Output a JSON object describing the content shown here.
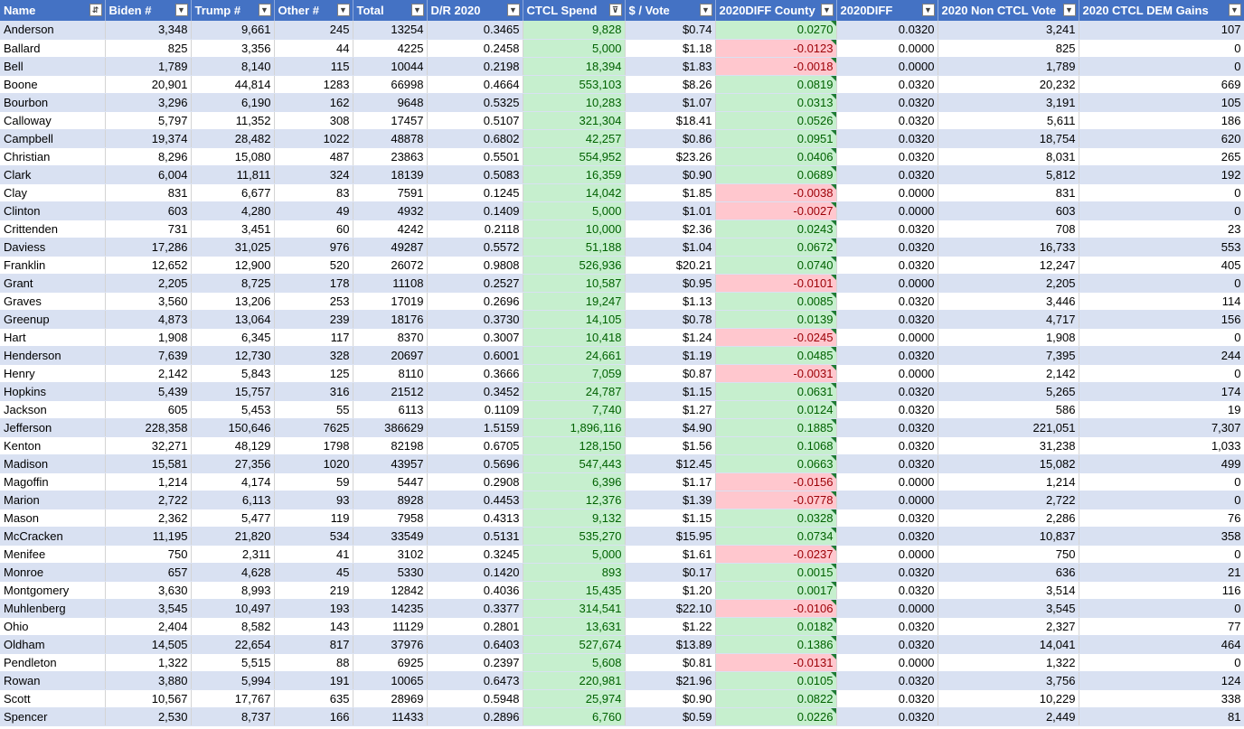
{
  "headers": [
    {
      "label": "Name",
      "filter_icon": "sort-asc-filter-icon"
    },
    {
      "label": "Biden #",
      "filter_icon": "filter-dropdown-icon"
    },
    {
      "label": "Trump #",
      "filter_icon": "filter-dropdown-icon"
    },
    {
      "label": "Other #",
      "filter_icon": "filter-dropdown-icon"
    },
    {
      "label": "Total",
      "filter_icon": "filter-dropdown-icon"
    },
    {
      "label": "D/R 2020",
      "filter_icon": "filter-dropdown-icon"
    },
    {
      "label": "CTCL Spend",
      "filter_icon": "filter-active-icon"
    },
    {
      "label": "$ / Vote",
      "filter_icon": "filter-dropdown-icon"
    },
    {
      "label": "2020DIFF County",
      "filter_icon": "filter-dropdown-icon"
    },
    {
      "label": "2020DIFF",
      "filter_icon": "filter-dropdown-icon"
    },
    {
      "label": "2020 Non CTCL Vote",
      "filter_icon": "filter-dropdown-icon"
    },
    {
      "label": "2020 CTCL DEM Gains",
      "filter_icon": "filter-dropdown-icon"
    }
  ],
  "colors": {
    "header_bg": "#4472c4",
    "band": "#d9e1f2",
    "good_fill": "#c6efce",
    "good_text": "#006100",
    "bad_fill": "#ffc7ce",
    "bad_text": "#9c0006"
  },
  "rows": [
    [
      "Anderson",
      "3,348",
      "9,661",
      "245",
      "13254",
      "0.3465",
      "9,828",
      "$0.74",
      "0.0270",
      "0.0320",
      "3,241",
      "107"
    ],
    [
      "Ballard",
      "825",
      "3,356",
      "44",
      "4225",
      "0.2458",
      "5,000",
      "$1.18",
      "-0.0123",
      "0.0000",
      "825",
      "0"
    ],
    [
      "Bell",
      "1,789",
      "8,140",
      "115",
      "10044",
      "0.2198",
      "18,394",
      "$1.83",
      "-0.0018",
      "0.0000",
      "1,789",
      "0"
    ],
    [
      "Boone",
      "20,901",
      "44,814",
      "1283",
      "66998",
      "0.4664",
      "553,103",
      "$8.26",
      "0.0819",
      "0.0320",
      "20,232",
      "669"
    ],
    [
      "Bourbon",
      "3,296",
      "6,190",
      "162",
      "9648",
      "0.5325",
      "10,283",
      "$1.07",
      "0.0313",
      "0.0320",
      "3,191",
      "105"
    ],
    [
      "Calloway",
      "5,797",
      "11,352",
      "308",
      "17457",
      "0.5107",
      "321,304",
      "$18.41",
      "0.0526",
      "0.0320",
      "5,611",
      "186"
    ],
    [
      "Campbell",
      "19,374",
      "28,482",
      "1022",
      "48878",
      "0.6802",
      "42,257",
      "$0.86",
      "0.0951",
      "0.0320",
      "18,754",
      "620"
    ],
    [
      "Christian",
      "8,296",
      "15,080",
      "487",
      "23863",
      "0.5501",
      "554,952",
      "$23.26",
      "0.0406",
      "0.0320",
      "8,031",
      "265"
    ],
    [
      "Clark",
      "6,004",
      "11,811",
      "324",
      "18139",
      "0.5083",
      "16,359",
      "$0.90",
      "0.0689",
      "0.0320",
      "5,812",
      "192"
    ],
    [
      "Clay",
      "831",
      "6,677",
      "83",
      "7591",
      "0.1245",
      "14,042",
      "$1.85",
      "-0.0038",
      "0.0000",
      "831",
      "0"
    ],
    [
      "Clinton",
      "603",
      "4,280",
      "49",
      "4932",
      "0.1409",
      "5,000",
      "$1.01",
      "-0.0027",
      "0.0000",
      "603",
      "0"
    ],
    [
      "Crittenden",
      "731",
      "3,451",
      "60",
      "4242",
      "0.2118",
      "10,000",
      "$2.36",
      "0.0243",
      "0.0320",
      "708",
      "23"
    ],
    [
      "Daviess",
      "17,286",
      "31,025",
      "976",
      "49287",
      "0.5572",
      "51,188",
      "$1.04",
      "0.0672",
      "0.0320",
      "16,733",
      "553"
    ],
    [
      "Franklin",
      "12,652",
      "12,900",
      "520",
      "26072",
      "0.9808",
      "526,936",
      "$20.21",
      "0.0740",
      "0.0320",
      "12,247",
      "405"
    ],
    [
      "Grant",
      "2,205",
      "8,725",
      "178",
      "11108",
      "0.2527",
      "10,587",
      "$0.95",
      "-0.0101",
      "0.0000",
      "2,205",
      "0"
    ],
    [
      "Graves",
      "3,560",
      "13,206",
      "253",
      "17019",
      "0.2696",
      "19,247",
      "$1.13",
      "0.0085",
      "0.0320",
      "3,446",
      "114"
    ],
    [
      "Greenup",
      "4,873",
      "13,064",
      "239",
      "18176",
      "0.3730",
      "14,105",
      "$0.78",
      "0.0139",
      "0.0320",
      "4,717",
      "156"
    ],
    [
      "Hart",
      "1,908",
      "6,345",
      "117",
      "8370",
      "0.3007",
      "10,418",
      "$1.24",
      "-0.0245",
      "0.0000",
      "1,908",
      "0"
    ],
    [
      "Henderson",
      "7,639",
      "12,730",
      "328",
      "20697",
      "0.6001",
      "24,661",
      "$1.19",
      "0.0485",
      "0.0320",
      "7,395",
      "244"
    ],
    [
      "Henry",
      "2,142",
      "5,843",
      "125",
      "8110",
      "0.3666",
      "7,059",
      "$0.87",
      "-0.0031",
      "0.0000",
      "2,142",
      "0"
    ],
    [
      "Hopkins",
      "5,439",
      "15,757",
      "316",
      "21512",
      "0.3452",
      "24,787",
      "$1.15",
      "0.0631",
      "0.0320",
      "5,265",
      "174"
    ],
    [
      "Jackson",
      "605",
      "5,453",
      "55",
      "6113",
      "0.1109",
      "7,740",
      "$1.27",
      "0.0124",
      "0.0320",
      "586",
      "19"
    ],
    [
      "Jefferson",
      "228,358",
      "150,646",
      "7625",
      "386629",
      "1.5159",
      "1,896,116",
      "$4.90",
      "0.1885",
      "0.0320",
      "221,051",
      "7,307"
    ],
    [
      "Kenton",
      "32,271",
      "48,129",
      "1798",
      "82198",
      "0.6705",
      "128,150",
      "$1.56",
      "0.1068",
      "0.0320",
      "31,238",
      "1,033"
    ],
    [
      "Madison",
      "15,581",
      "27,356",
      "1020",
      "43957",
      "0.5696",
      "547,443",
      "$12.45",
      "0.0663",
      "0.0320",
      "15,082",
      "499"
    ],
    [
      "Magoffin",
      "1,214",
      "4,174",
      "59",
      "5447",
      "0.2908",
      "6,396",
      "$1.17",
      "-0.0156",
      "0.0000",
      "1,214",
      "0"
    ],
    [
      "Marion",
      "2,722",
      "6,113",
      "93",
      "8928",
      "0.4453",
      "12,376",
      "$1.39",
      "-0.0778",
      "0.0000",
      "2,722",
      "0"
    ],
    [
      "Mason",
      "2,362",
      "5,477",
      "119",
      "7958",
      "0.4313",
      "9,132",
      "$1.15",
      "0.0328",
      "0.0320",
      "2,286",
      "76"
    ],
    [
      "McCracken",
      "11,195",
      "21,820",
      "534",
      "33549",
      "0.5131",
      "535,270",
      "$15.95",
      "0.0734",
      "0.0320",
      "10,837",
      "358"
    ],
    [
      "Menifee",
      "750",
      "2,311",
      "41",
      "3102",
      "0.3245",
      "5,000",
      "$1.61",
      "-0.0237",
      "0.0000",
      "750",
      "0"
    ],
    [
      "Monroe",
      "657",
      "4,628",
      "45",
      "5330",
      "0.1420",
      "893",
      "$0.17",
      "0.0015",
      "0.0320",
      "636",
      "21"
    ],
    [
      "Montgomery",
      "3,630",
      "8,993",
      "219",
      "12842",
      "0.4036",
      "15,435",
      "$1.20",
      "0.0017",
      "0.0320",
      "3,514",
      "116"
    ],
    [
      "Muhlenberg",
      "3,545",
      "10,497",
      "193",
      "14235",
      "0.3377",
      "314,541",
      "$22.10",
      "-0.0106",
      "0.0000",
      "3,545",
      "0"
    ],
    [
      "Ohio",
      "2,404",
      "8,582",
      "143",
      "11129",
      "0.2801",
      "13,631",
      "$1.22",
      "0.0182",
      "0.0320",
      "2,327",
      "77"
    ],
    [
      "Oldham",
      "14,505",
      "22,654",
      "817",
      "37976",
      "0.6403",
      "527,674",
      "$13.89",
      "0.1386",
      "0.0320",
      "14,041",
      "464"
    ],
    [
      "Pendleton",
      "1,322",
      "5,515",
      "88",
      "6925",
      "0.2397",
      "5,608",
      "$0.81",
      "-0.0131",
      "0.0000",
      "1,322",
      "0"
    ],
    [
      "Rowan",
      "3,880",
      "5,994",
      "191",
      "10065",
      "0.6473",
      "220,981",
      "$21.96",
      "0.0105",
      "0.0320",
      "3,756",
      "124"
    ],
    [
      "Scott",
      "10,567",
      "17,767",
      "635",
      "28969",
      "0.5948",
      "25,974",
      "$0.90",
      "0.0822",
      "0.0320",
      "10,229",
      "338"
    ],
    [
      "Spencer",
      "2,530",
      "8,737",
      "166",
      "11433",
      "0.2896",
      "6,760",
      "$0.59",
      "0.0226",
      "0.0320",
      "2,449",
      "81"
    ]
  ]
}
